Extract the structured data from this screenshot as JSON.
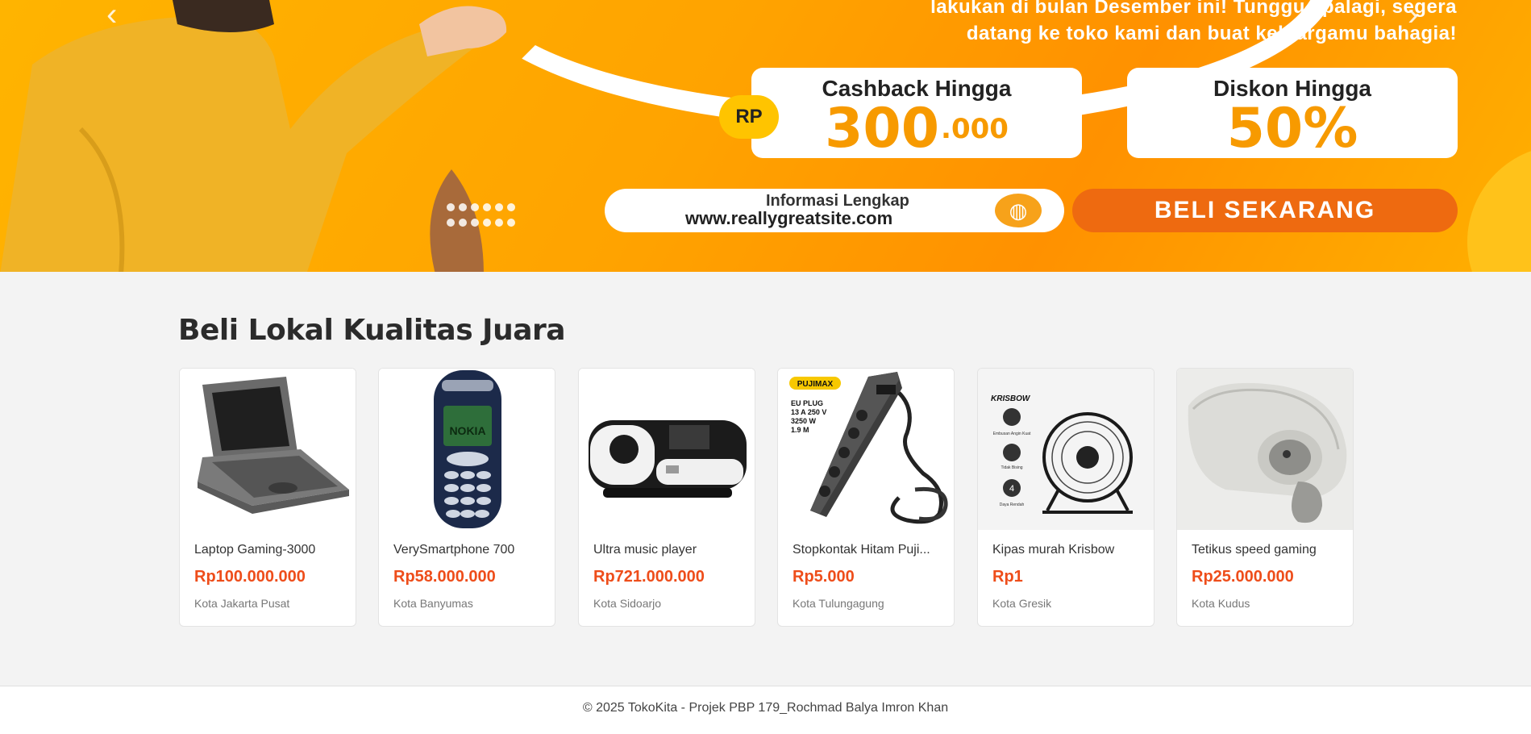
{
  "banner": {
    "promo_line1": "lakukan di bulan Desember ini! Tunggu apalagi, segera",
    "promo_line2": "datang ke toko kami dan buat keluargamu bahagia!",
    "cashback_caption": "Cashback Hingga",
    "rp_badge": "RP",
    "cashback_amount": "300",
    "cashback_suffix": ".000",
    "diskon_caption": "Diskon Hingga",
    "diskon_amount": "50%",
    "info_label": "Informasi Lengkap",
    "info_url": "www.reallygreatsite.com",
    "buy_label": "BELI SEKARANG",
    "prev_arrow": "‹",
    "next_arrow": "›",
    "colors": {
      "orange": "#ffa300",
      "button": "#ee6a10",
      "accent_text": "#f79a00"
    }
  },
  "section": {
    "title": "Beli Lokal Kualitas Juara"
  },
  "products": [
    {
      "name": "Laptop Gaming-3000",
      "price": "Rp100.000.000",
      "city": "Kota Jakarta Pusat"
    },
    {
      "name": "VerySmartphone 700",
      "price": "Rp58.000.000",
      "city": "Kota Banyumas"
    },
    {
      "name": "Ultra music player",
      "price": "Rp721.000.000",
      "city": "Kota Sidoarjo"
    },
    {
      "name": "Stopkontak Hitam Puji...",
      "price": "Rp5.000",
      "city": "Kota Tulungagung"
    },
    {
      "name": "Kipas murah Krisbow",
      "price": "Rp1",
      "city": "Kota Gresik"
    },
    {
      "name": "Tetikus speed gaming",
      "price": "Rp25.000.000",
      "city": "Kota Kudus"
    }
  ],
  "product_images": {
    "nokia_label": "NOKIA",
    "pujimax_label": "PUJIMAX",
    "plug_spec": [
      "EU PLUG",
      "13 A 250 V",
      "3250 W",
      "1.9 M"
    ],
    "krisbow_label": "KRISBOW",
    "krisbow_feats": [
      "Embusan Angin Kuat",
      "Tidak Bising",
      "Daya Rendah"
    ]
  },
  "footer": {
    "text": "© 2025 TokoKita - Projek PBP 179_Rochmad Balya Imron Khan"
  }
}
